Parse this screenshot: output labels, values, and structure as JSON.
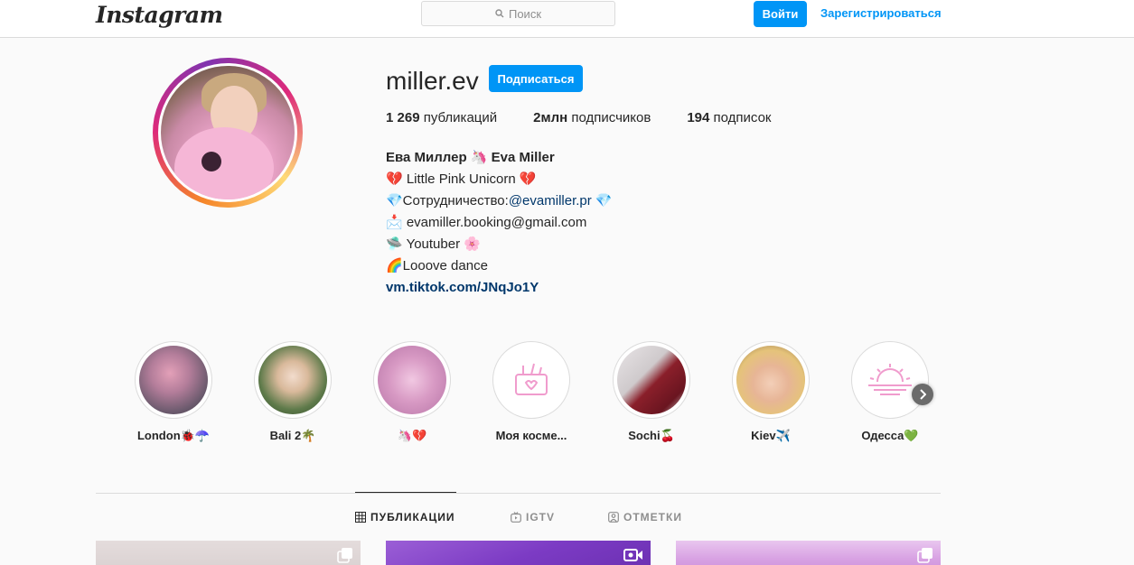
{
  "header": {
    "logo": "Instagram",
    "search_placeholder": "Поиск",
    "login_label": "Войти",
    "register_label": "Зарегистрироваться"
  },
  "profile": {
    "username": "miller.ev",
    "follow_label": "Подписаться",
    "stats": [
      {
        "count": "1 269",
        "label": "публикаций"
      },
      {
        "count": "2млн",
        "label": "подписчиков"
      },
      {
        "count": "194",
        "label": "подписок"
      }
    ],
    "bio": {
      "name": "Ева Миллер 🦄 Eva Miller",
      "lines": [
        "💔 Little Pink Unicorn 💔",
        "💎Сотрудничество:",
        "@evamiller.pr",
        " 💎",
        "📩 evamiller.booking@gmail.com",
        "🛸 Youtuber 🌸",
        "🌈Looove dance"
      ],
      "link": "vm.tiktok.com/JNqJo1Y"
    }
  },
  "highlights": [
    {
      "label": "London🐞☂️"
    },
    {
      "label": "Bali 2🌴"
    },
    {
      "label": "🦄💔"
    },
    {
      "label": "Моя косме..."
    },
    {
      "label": "Sochi🍒"
    },
    {
      "label": "Kiev✈️"
    },
    {
      "label": "Одесса💚"
    }
  ],
  "tabs": [
    {
      "label": "ПУБЛИКАЦИИ",
      "icon": "grid-icon"
    },
    {
      "label": "IGTV",
      "icon": "igtv-icon"
    },
    {
      "label": "ОТМЕТКИ",
      "icon": "tagged-icon"
    }
  ],
  "colors": {
    "accent": "#0095f6",
    "link": "#00376b",
    "text": "#262626",
    "muted": "#8e8e8e",
    "border": "#dbdbdb",
    "background": "#fafafa"
  }
}
